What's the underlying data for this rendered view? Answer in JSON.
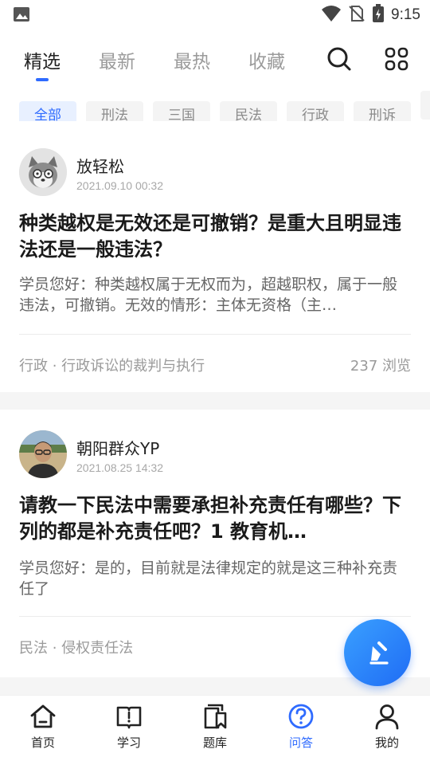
{
  "status_bar": {
    "time": "9:15"
  },
  "top_tabs": [
    {
      "label": "精选",
      "active": true
    },
    {
      "label": "最新",
      "active": false
    },
    {
      "label": "最热",
      "active": false
    },
    {
      "label": "收藏",
      "active": false
    }
  ],
  "top_icons": {
    "search": "search-icon",
    "grid": "grid-icon"
  },
  "categories": [
    "全部",
    "刑法",
    "三国",
    "民法",
    "行政",
    "刑诉"
  ],
  "posts": [
    {
      "author": "放轻松",
      "date": "2021.09.10  00:32",
      "title": "种类越权是无效还是可撤销？是重大且明显违法还是一般违法？",
      "answer": "学员您好：种类越权属于无权而为，超越职权，属于一般违法，可撤销。无效的情形：主体无资格（主…",
      "tags": "行政 · 行政诉讼的裁判与执行",
      "views": "237 浏览"
    },
    {
      "author": "朝阳群众YP",
      "date": "2021.08.25  14:32",
      "title": "请教一下民法中需要承担补充责任有哪些？下列的都是补充责任吧？1 教育机…",
      "answer": "学员您好：是的，目前就是法律规定的就是这三种补充责任了",
      "tags": "民法 · 侵权责任法",
      "views": ""
    }
  ],
  "bottom_nav": [
    {
      "label": "首页",
      "icon": "home-icon",
      "active": false
    },
    {
      "label": "学习",
      "icon": "book-icon",
      "active": false
    },
    {
      "label": "题库",
      "icon": "question-bank-icon",
      "active": false
    },
    {
      "label": "问答",
      "icon": "qa-icon",
      "active": true
    },
    {
      "label": "我的",
      "icon": "profile-icon",
      "active": false
    }
  ],
  "colors": {
    "accent": "#2f6bff",
    "inactive_tab": "#9b9b9b",
    "chip_bg": "#f4f4f4"
  }
}
